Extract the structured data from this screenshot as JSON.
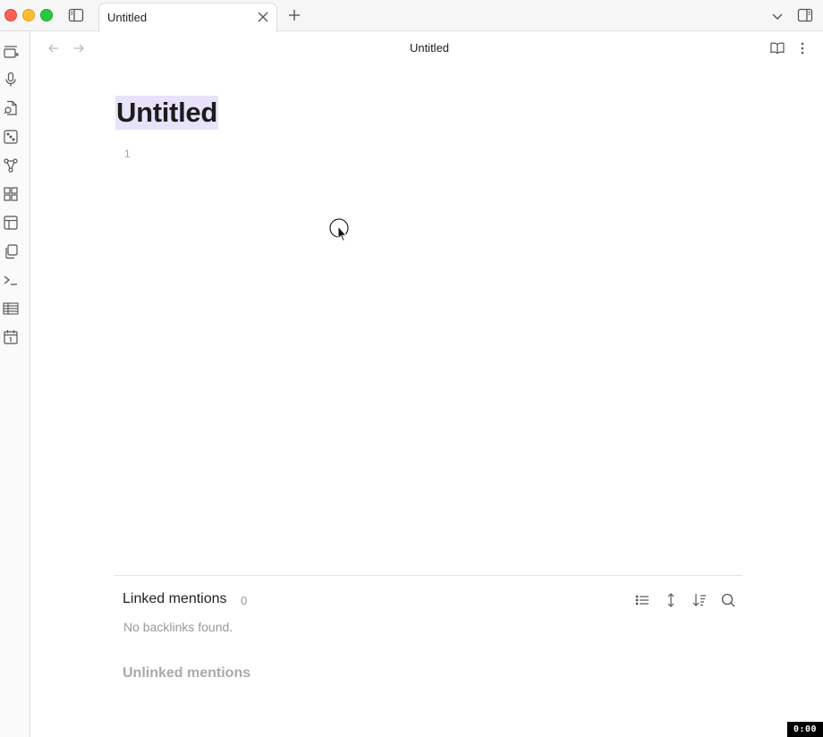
{
  "tabs": [
    {
      "label": "Untitled"
    }
  ],
  "header": {
    "title": "Untitled"
  },
  "editor": {
    "title": "Untitled",
    "line_number": "1"
  },
  "backlinks": {
    "linked_title": "Linked mentions",
    "linked_count": "0",
    "empty_message": "No backlinks found.",
    "unlinked_title": "Unlinked mentions"
  },
  "ribbon": {
    "icons": [
      "new-tab-icon",
      "microphone-icon",
      "file-recovery-icon",
      "dice-icon",
      "graph-icon",
      "blocks-icon",
      "template-icon",
      "copy-icon",
      "terminal-icon",
      "table-icon",
      "calendar-icon"
    ]
  },
  "colors": {
    "title_highlight": "#e8e2fb",
    "accent_red": "#ff5f57",
    "accent_yellow": "#febc2e",
    "accent_green": "#28c840"
  },
  "recording_timer": "0:00"
}
